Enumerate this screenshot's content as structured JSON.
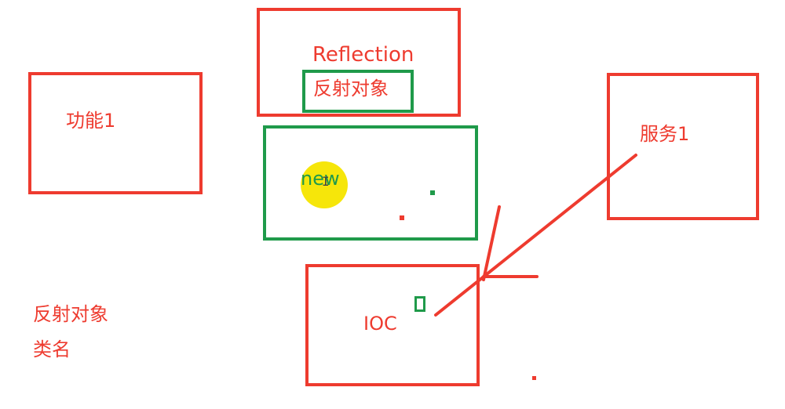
{
  "colors": {
    "red": "#ee3b2f",
    "green": "#1f9a4a",
    "highlight": "#f6e60a"
  },
  "labels": {
    "reflection": "Reflection",
    "reflect_object": "反射对象",
    "func1": "功能1",
    "service1": "服务1",
    "ioc": "IOC",
    "new": "new",
    "note_line1": "反射对象",
    "note_line2": "类名"
  },
  "icons": {
    "cursor": "text-cursor-icon"
  }
}
